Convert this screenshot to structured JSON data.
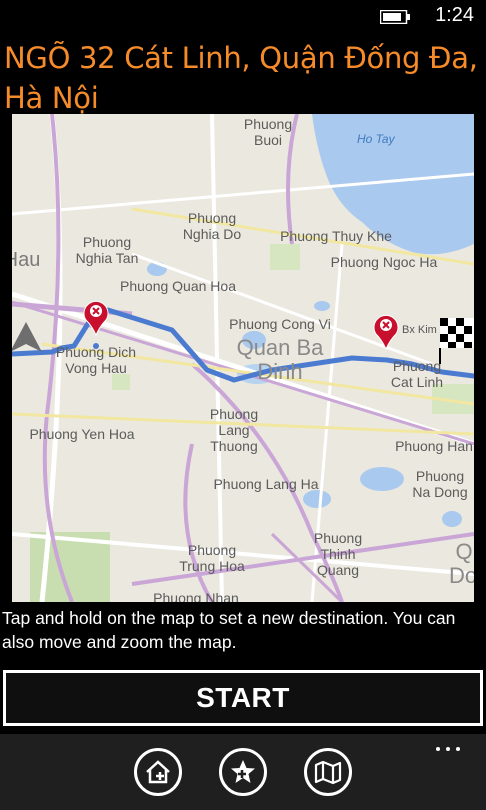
{
  "status_bar": {
    "time": "1:24",
    "battery_icon": "battery-icon"
  },
  "title": "NGÕ 32 Cát Linh, Quận Đống Đa, Hà Nội",
  "map": {
    "labels": [
      {
        "text": "Phuong Buoi"
      },
      {
        "text": "Ho Tay"
      },
      {
        "text": "Phuong Nghia Do"
      },
      {
        "text": "Phuong Thuy Khe"
      },
      {
        "text": "Phuong Nghia Tan"
      },
      {
        "text": "Phuong Ngoc Ha"
      },
      {
        "text": "Hau"
      },
      {
        "text": "Phuong Quan Hoa"
      },
      {
        "text": "Phuong Cong Vi"
      },
      {
        "text": "Bx Kim"
      },
      {
        "text": "Quan Ba Dinh"
      },
      {
        "text": "Phuong Dich Vong Hau"
      },
      {
        "text": "Phuong Cat Linh"
      },
      {
        "text": "Phuong Yen Hoa"
      },
      {
        "text": "Phuong Lang Thuong"
      },
      {
        "text": "Phuong Han"
      },
      {
        "text": "Phuong Na Dong"
      },
      {
        "text": "Phuong Lang Ha"
      },
      {
        "text": "Phuong Thinh Quang"
      },
      {
        "text": "Phuong Trung Hoa"
      },
      {
        "text": "Q Dor"
      },
      {
        "text": "Phuong Nhan"
      }
    ],
    "icons": [
      "current-location-arrow-icon",
      "start-pin-icon",
      "destination-pin-icon",
      "finish-flag-icon"
    ]
  },
  "instructions": "Tap and hold on the map to set a new destination. You can also move and zoom the map.",
  "start_label": "START",
  "app_bar": {
    "buttons": [
      "add-home-icon",
      "add-favorite-icon",
      "map-icon"
    ],
    "more": "more-icon"
  },
  "colors": {
    "accent": "#f68b2a",
    "route": "#4a7bd1",
    "water": "#a9c9ef",
    "pin": "#c8102e"
  }
}
